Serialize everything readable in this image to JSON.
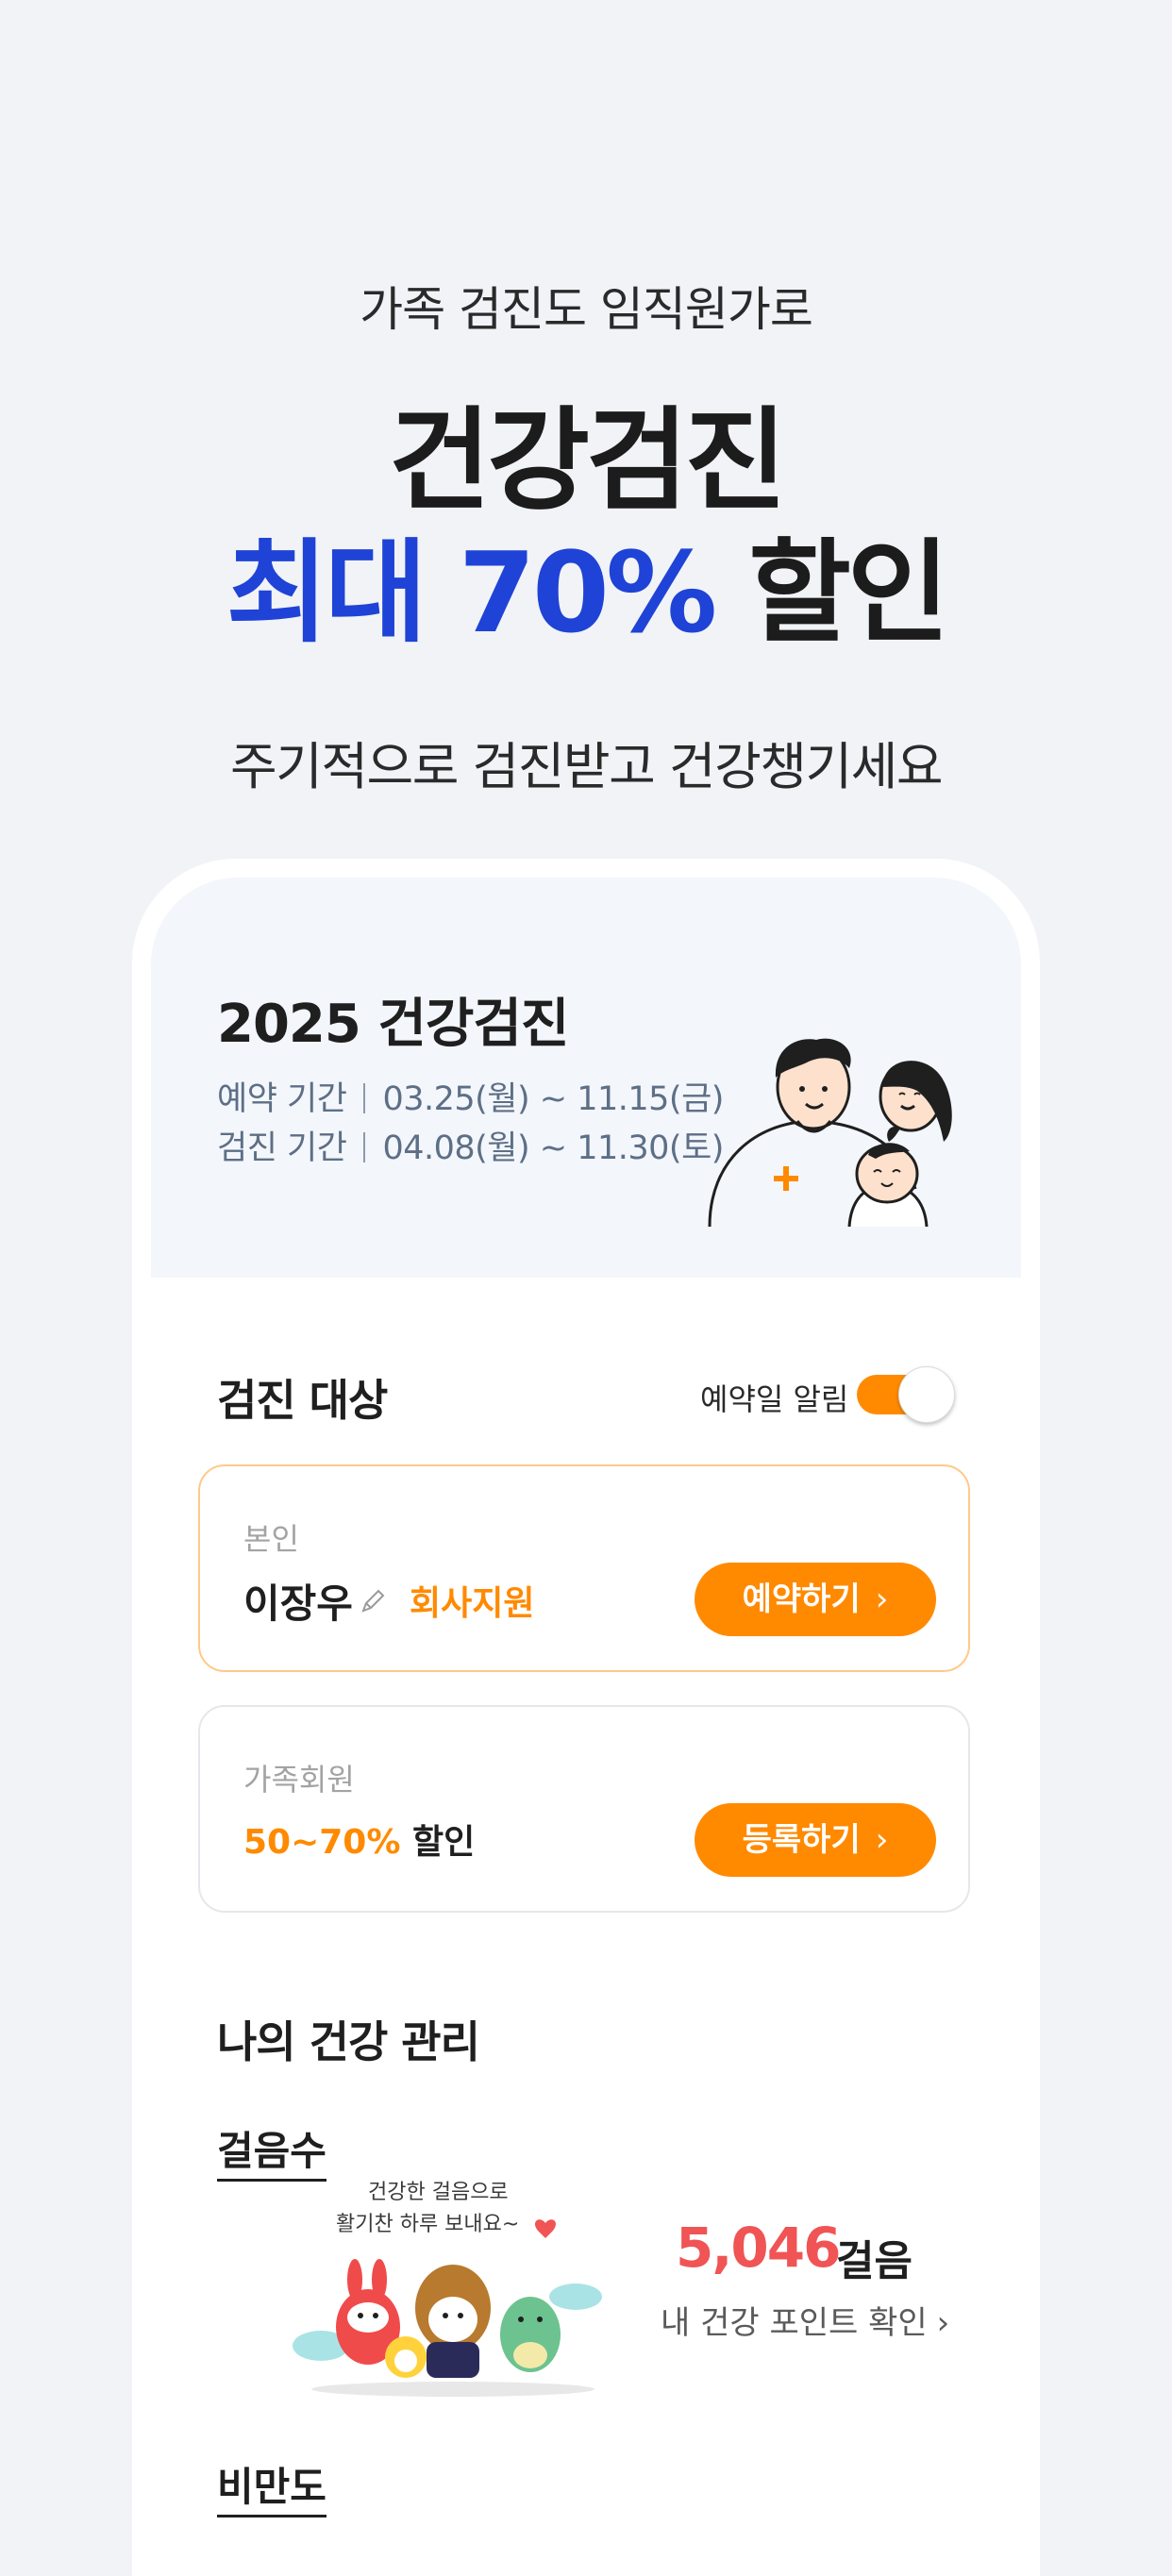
{
  "hero": {
    "subtitle": "가족 검진도 임직원가로",
    "headline_line1": "건강검진",
    "headline_accent": "최대 70%",
    "headline_rest": " 할인",
    "tagline": "주기적으로 검진받고 건강챙기세요",
    "accent_color": "#1f43d6"
  },
  "banner": {
    "title": "2025 건강검진",
    "reservation_label": "예약 기간",
    "reservation_period": "03.25(월) ~ 11.15(금)",
    "checkup_label": "검진 기간",
    "checkup_period": "04.08(월) ~ 11.30(토)",
    "illustration": "family-illustration"
  },
  "targets": {
    "title": "검진 대상",
    "alarm_label": "예약일 알림",
    "alarm_on": true,
    "self_card": {
      "label": "본인",
      "name": "이장우",
      "support": "회사지원",
      "button": "예약하기"
    },
    "family_card": {
      "label": "가족회원",
      "discount_pct": "50~70%",
      "discount_text": " 할인",
      "button": "등록하기"
    }
  },
  "health": {
    "title": "나의 건강 관리",
    "steps_label": "걸음수",
    "mascot_caption_line1": "건강한 걸음으로",
    "mascot_caption_line2": "활기찬 하루 보내요~",
    "steps_value": "5,046",
    "steps_unit": "걸음",
    "points_link": "내 건강 포인트 확인",
    "bmi_label": "비만도"
  },
  "colors": {
    "brand_orange": "#ff8a00",
    "steps_red": "#f05454"
  }
}
